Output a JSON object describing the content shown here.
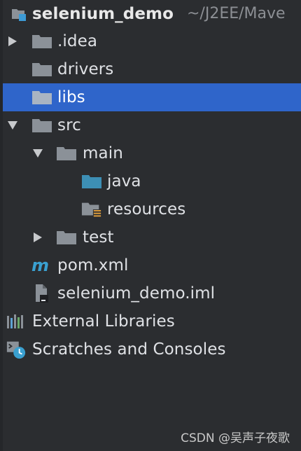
{
  "project_tree": {
    "root": {
      "name": "selenium_demo",
      "path": "~/J2EE/Mave"
    },
    "items": [
      {
        "label": ".idea"
      },
      {
        "label": "drivers"
      },
      {
        "label": "libs"
      },
      {
        "label": "src"
      },
      {
        "label": "main"
      },
      {
        "label": "java"
      },
      {
        "label": "resources"
      },
      {
        "label": "test"
      },
      {
        "label": "pom.xml"
      },
      {
        "label": "selenium_demo.iml"
      }
    ],
    "external_libraries": {
      "label": "External Libraries"
    },
    "scratches": {
      "label": "Scratches and Consoles"
    }
  },
  "watermark": "CSDN @吴声子夜歌",
  "colors": {
    "background": "#2b2d30",
    "selection": "#2f65ca",
    "folder": "#8b9198",
    "source_folder": "#3d8fb5",
    "maven": "#3aa0d0",
    "resources_badge": "#e8a33d"
  },
  "icons": {
    "collapsed_arrow": "chevron-right-icon",
    "expanded_arrow": "chevron-down-icon",
    "folder": "folder-icon",
    "source_folder": "source-folder-icon",
    "resources_folder": "resources-folder-icon",
    "maven_file": "maven-icon",
    "module_file": "module-file-icon",
    "external_libraries": "libraries-icon",
    "scratches": "scratches-icon"
  }
}
